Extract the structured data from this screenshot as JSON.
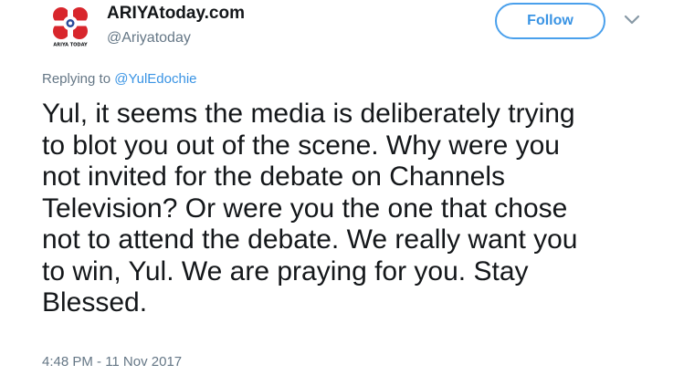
{
  "author": {
    "display_name": "ARIYAtoday.com",
    "handle": "@Ariyatoday",
    "avatar_icon": "ariya-today-logo",
    "avatar_caption": "ARIYA TODAY"
  },
  "actions": {
    "follow_label": "Follow",
    "more_icon": "chevron-down-icon"
  },
  "reply": {
    "prefix": "Replying to",
    "mention": "@YulEdochie"
  },
  "tweet": {
    "lines": [
      "Yul, it seems the media is deliberately trying",
      "to blot you out of the scene. Why were you",
      "not invited for the debate on Channels",
      "Television? Or were you the one that chose",
      "not to attend the debate. We really want you",
      "to win, Yul. We are praying for you. Stay",
      "Blessed."
    ],
    "timestamp": "4:48 PM - 11 Nov 2017"
  },
  "colors": {
    "accent": "#3a94e4",
    "logo_red": "#d8262c",
    "logo_blue": "#2b4c9b",
    "muted_text": "#657786"
  }
}
